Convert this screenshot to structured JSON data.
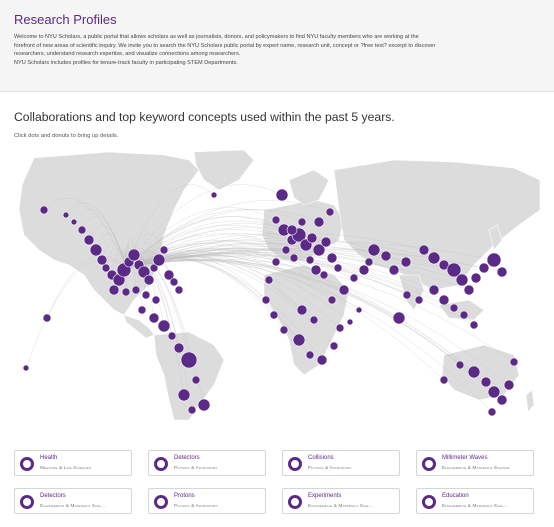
{
  "intro": {
    "title": "Research Profiles",
    "description_lines": [
      "Welcome to NYU Scholars, a public portal that allows scholars as well as journalists, donors, and policymakers to find NYU faculty members who are working at the",
      "forefront of new areas of scientific inquiry. We invite you to search the NYU Scholars public portal by expert name, research unit, concept or ?free text? excerpt to discover",
      "researchers, understand research expertise, and visualize connections among researchers.",
      "NYU Scholars includes profiles for tenure-track faculty in participating STEM Departments."
    ]
  },
  "section": {
    "title": "Collaborations and top keyword concepts used within the past 5 years.",
    "hint": "Click dots and donuts to bring up details."
  },
  "map": {
    "land_color": "#dcdcdc",
    "line_color": "#bdbdbd",
    "dot_color": "#5b2a86"
  },
  "concepts": [
    {
      "name": "Health",
      "category": "Medicine & Life Sciences"
    },
    {
      "name": "Detectors",
      "category": "Physics & Astronomy"
    },
    {
      "name": "Collisions",
      "category": "Physics & Astronomy"
    },
    {
      "name": "Millimeter Waves",
      "category": "Engineering & Materials Science"
    },
    {
      "name": "Detectors",
      "category": "Engineering & Materials Scie..."
    },
    {
      "name": "Protons",
      "category": "Physics & Astronomy"
    },
    {
      "name": "Experiments",
      "category": "Engineering & Materials Scie..."
    },
    {
      "name": "Education",
      "category": "Engineering & Materials Scie..."
    }
  ]
}
